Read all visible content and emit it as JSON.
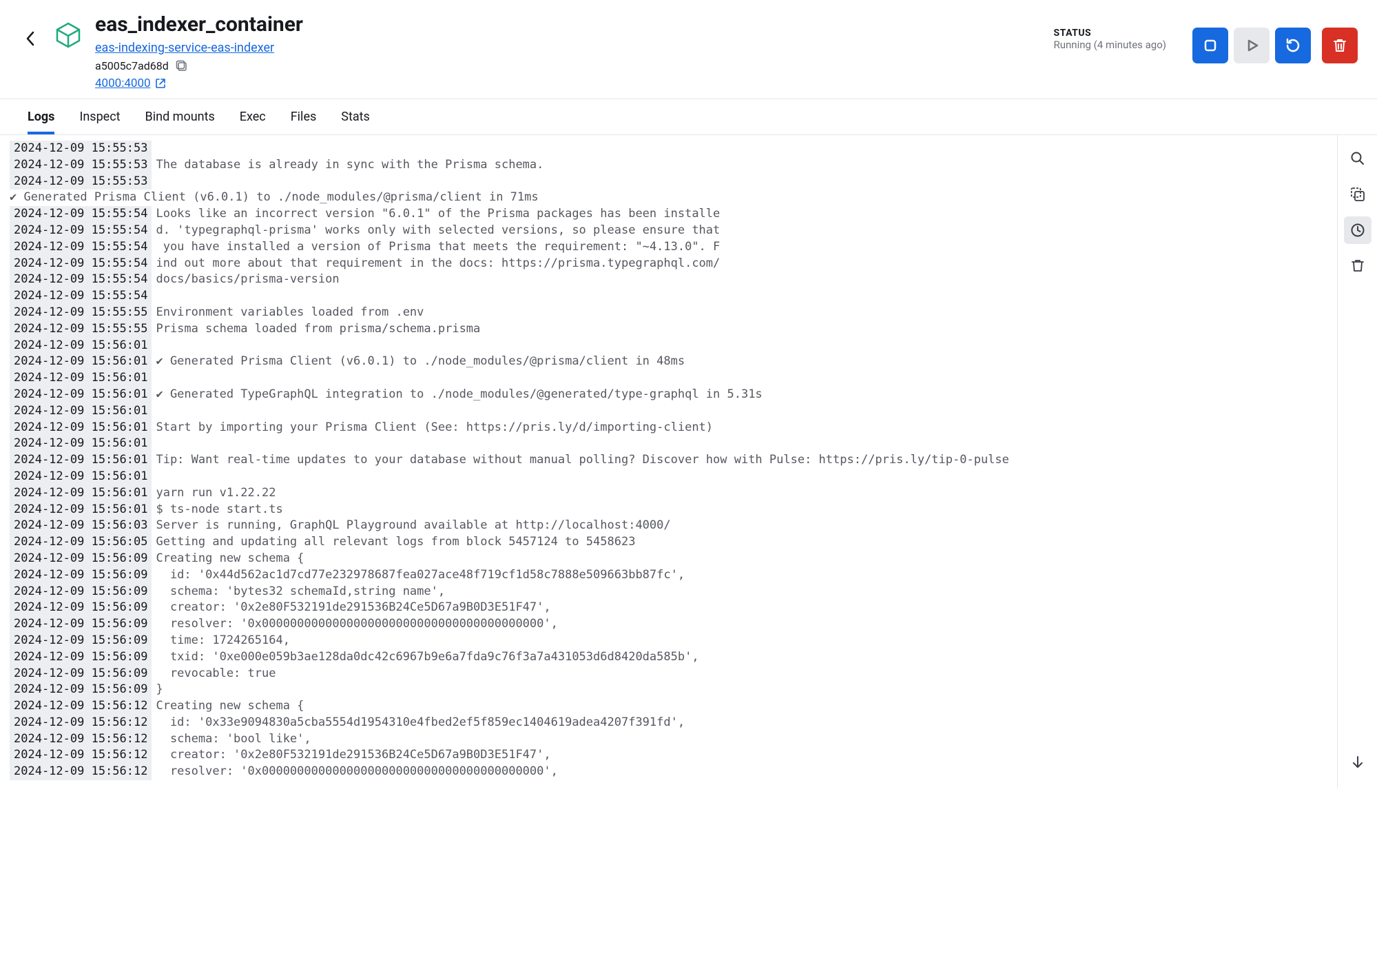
{
  "header": {
    "title": "eas_indexer_container",
    "service_link": "eas-indexing-service-eas-indexer",
    "container_id": "a5005c7ad68d",
    "port_mapping": "4000:4000"
  },
  "status": {
    "label": "STATUS",
    "text": "Running (4 minutes ago)"
  },
  "tabs": [
    {
      "label": "Logs",
      "active": true
    },
    {
      "label": "Inspect",
      "active": false
    },
    {
      "label": "Bind mounts",
      "active": false
    },
    {
      "label": "Exec",
      "active": false
    },
    {
      "label": "Files",
      "active": false
    },
    {
      "label": "Stats",
      "active": false
    }
  ],
  "logs": [
    {
      "ts": "2024-12-09 15:55:53",
      "msg": ""
    },
    {
      "ts": "2024-12-09 15:55:53",
      "msg": "The database is already in sync with the Prisma schema."
    },
    {
      "ts": "2024-12-09 15:55:53",
      "msg": ""
    },
    {
      "ts": "",
      "msg": "✔ Generated Prisma Client (v6.0.1) to ./node_modules/@prisma/client in 71ms"
    },
    {
      "ts": "2024-12-09 15:55:54",
      "msg": "Looks like an incorrect version \"6.0.1\" of the Prisma packages has been installe"
    },
    {
      "ts": "2024-12-09 15:55:54",
      "msg": "d. 'typegraphql-prisma' works only with selected versions, so please ensure that"
    },
    {
      "ts": "2024-12-09 15:55:54",
      "msg": " you have installed a version of Prisma that meets the requirement: \"~4.13.0\". F"
    },
    {
      "ts": "2024-12-09 15:55:54",
      "msg": "ind out more about that requirement in the docs: https://prisma.typegraphql.com/"
    },
    {
      "ts": "2024-12-09 15:55:54",
      "msg": "docs/basics/prisma-version"
    },
    {
      "ts": "2024-12-09 15:55:54",
      "msg": ""
    },
    {
      "ts": "2024-12-09 15:55:55",
      "msg": "Environment variables loaded from .env"
    },
    {
      "ts": "2024-12-09 15:55:55",
      "msg": "Prisma schema loaded from prisma/schema.prisma"
    },
    {
      "ts": "2024-12-09 15:56:01",
      "msg": ""
    },
    {
      "ts": "2024-12-09 15:56:01",
      "msg": "✔ Generated Prisma Client (v6.0.1) to ./node_modules/@prisma/client in 48ms"
    },
    {
      "ts": "2024-12-09 15:56:01",
      "msg": ""
    },
    {
      "ts": "2024-12-09 15:56:01",
      "msg": "✔ Generated TypeGraphQL integration to ./node_modules/@generated/type-graphql in 5.31s"
    },
    {
      "ts": "2024-12-09 15:56:01",
      "msg": ""
    },
    {
      "ts": "2024-12-09 15:56:01",
      "msg": "Start by importing your Prisma Client (See: https://pris.ly/d/importing-client)"
    },
    {
      "ts": "2024-12-09 15:56:01",
      "msg": ""
    },
    {
      "ts": "2024-12-09 15:56:01",
      "msg": "Tip: Want real-time updates to your database without manual polling? Discover how with Pulse: https://pris.ly/tip-0-pulse"
    },
    {
      "ts": "2024-12-09 15:56:01",
      "msg": ""
    },
    {
      "ts": "2024-12-09 15:56:01",
      "msg": "yarn run v1.22.22"
    },
    {
      "ts": "2024-12-09 15:56:01",
      "msg": "$ ts-node start.ts"
    },
    {
      "ts": "2024-12-09 15:56:03",
      "msg": "Server is running, GraphQL Playground available at http://localhost:4000/"
    },
    {
      "ts": "2024-12-09 15:56:05",
      "msg": "Getting and updating all relevant logs from block 5457124 to 5458623"
    },
    {
      "ts": "2024-12-09 15:56:09",
      "msg": "Creating new schema {"
    },
    {
      "ts": "2024-12-09 15:56:09",
      "msg": "  id: '0x44d562ac1d7cd77e232978687fea027ace48f719cf1d58c7888e509663bb87fc',"
    },
    {
      "ts": "2024-12-09 15:56:09",
      "msg": "  schema: 'bytes32 schemaId,string name',"
    },
    {
      "ts": "2024-12-09 15:56:09",
      "msg": "  creator: '0x2e80F532191de291536B24Ce5D67a9B0D3E51F47',"
    },
    {
      "ts": "2024-12-09 15:56:09",
      "msg": "  resolver: '0x0000000000000000000000000000000000000000',"
    },
    {
      "ts": "2024-12-09 15:56:09",
      "msg": "  time: 1724265164,"
    },
    {
      "ts": "2024-12-09 15:56:09",
      "msg": "  txid: '0xe000e059b3ae128da0dc42c6967b9e6a7fda9c76f3a7a431053d6d8420da585b',"
    },
    {
      "ts": "2024-12-09 15:56:09",
      "msg": "  revocable: true"
    },
    {
      "ts": "2024-12-09 15:56:09",
      "msg": "}"
    },
    {
      "ts": "2024-12-09 15:56:12",
      "msg": "Creating new schema {"
    },
    {
      "ts": "2024-12-09 15:56:12",
      "msg": "  id: '0x33e9094830a5cba5554d1954310e4fbed2ef5f859ec1404619adea4207f391fd',"
    },
    {
      "ts": "2024-12-09 15:56:12",
      "msg": "  schema: 'bool like',"
    },
    {
      "ts": "2024-12-09 15:56:12",
      "msg": "  creator: '0x2e80F532191de291536B24Ce5D67a9B0D3E51F47',"
    },
    {
      "ts": "2024-12-09 15:56:12",
      "msg": "  resolver: '0x0000000000000000000000000000000000000000',"
    }
  ]
}
